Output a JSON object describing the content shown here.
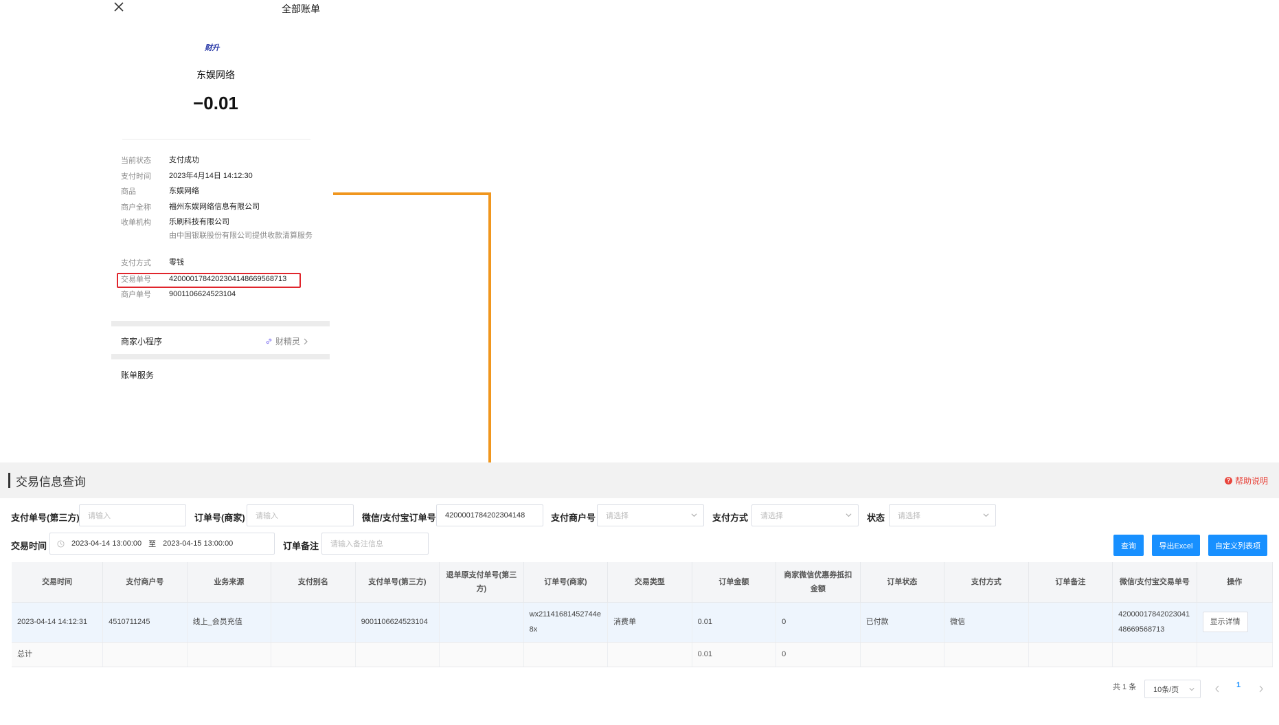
{
  "bill": {
    "title": "全部账单",
    "logo_text": "财升",
    "merchant_name": "东娱网络",
    "amount": "−0.01",
    "fields": [
      {
        "key": "当前状态",
        "value": "支付成功"
      },
      {
        "key": "支付时间",
        "value": "2023年4月14日 14:12:30"
      },
      {
        "key": "商品",
        "value": "东娱网络"
      },
      {
        "key": "商户全称",
        "value": "福州东娱网络信息有限公司"
      },
      {
        "key": "收单机构",
        "value": "乐刷科技有限公司",
        "sub": "由中国银联股份有限公司提供收款清算服务"
      },
      {
        "key": "支付方式",
        "value": "零钱"
      },
      {
        "key": "交易单号",
        "value": "4200001784202304148669568713"
      },
      {
        "key": "商户单号",
        "value": "9001106624523104"
      }
    ],
    "mini_program_label": "商家小程序",
    "mini_program_link": "财精灵",
    "bill_service_label": "账单服务"
  },
  "panel": {
    "title": "交易信息查询",
    "help_label": "帮助说明",
    "filters": {
      "third_party_no_label": "支付单号(第三方)",
      "third_party_no_placeholder": "请输入",
      "order_no_label": "订单号(商家)",
      "order_no_placeholder": "请输入",
      "wx_alipay_no_label": "微信/支付宝订单号",
      "wx_alipay_no_value": "4200001784202304148",
      "merchant_no_label": "支付商户号",
      "merchant_no_placeholder": "请选择",
      "pay_method_label": "支付方式",
      "pay_method_placeholder": "请选择",
      "status_label": "状态",
      "status_placeholder": "请选择",
      "trade_time_label": "交易时间",
      "date_start": "2023-04-14 13:00:00",
      "date_sep": "至",
      "date_end": "2023-04-15 13:00:00",
      "order_remark_label": "订单备注",
      "order_remark_placeholder": "请输入备注信息"
    },
    "buttons": {
      "query": "查询",
      "export": "导出Excel",
      "custom_columns": "自定义列表项"
    },
    "table": {
      "headers": [
        "交易时间",
        "支付商户号",
        "业务来源",
        "支付别名",
        "支付单号(第三方)",
        "退单原支付单号(第三方)",
        "订单号(商家)",
        "交易类型",
        "订单金额",
        "商家微信优惠券抵扣金额",
        "订单状态",
        "支付方式",
        "订单备注",
        "微信/支付宝交易单号",
        "操作"
      ],
      "row": {
        "trade_time": "2023-04-14 14:12:31",
        "merchant_no": "4510711245",
        "biz_source": "线上_会员充值",
        "pay_alias": "",
        "third_party_no": "9001106624523104",
        "refund_orig_no": "",
        "order_no": "wx21141681452744e8x",
        "trade_type": "消费单",
        "order_amount": "0.01",
        "coupon_amount": "0",
        "order_status": "已付款",
        "pay_method": "微信",
        "order_remark": "",
        "wx_trade_no": "4200001784202304148669568713",
        "action_label": "显示详情"
      },
      "total": {
        "label": "总计",
        "order_amount": "0.01",
        "coupon_amount": "0"
      }
    },
    "pager": {
      "total_text": "共 1 条",
      "page_size": "10条/页",
      "current_page": "1"
    }
  },
  "colors": {
    "accent": "#1890ff",
    "arrow": "#f0961e",
    "highlight_box": "#e0252c",
    "help": "#e8453c"
  }
}
